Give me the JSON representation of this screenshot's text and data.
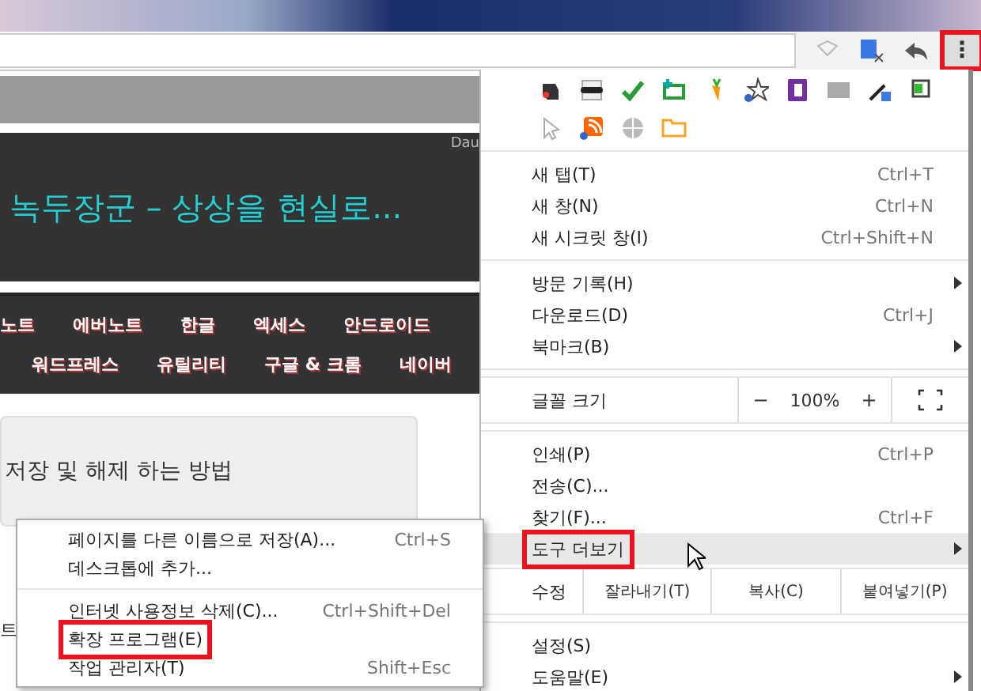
{
  "toolbar": {
    "menu_button": {
      "label": "⋮",
      "highlighted": true
    }
  },
  "page": {
    "banner_title": "녹두장군 – 상상을 현실로...",
    "banner_corner": "Dau",
    "nav_rows": [
      [
        "노트",
        "에버노트",
        "한글",
        "엑세스",
        "안드로이드"
      ],
      [
        "워드프레스",
        "유틸리티",
        "구글 & 크롬",
        "네이버"
      ]
    ],
    "post_title": "저장 및 해제 하는 방법",
    "edge_text": "트"
  },
  "menu": {
    "entries": [
      {
        "kind": "item",
        "label": "새 탭(T)",
        "shortcut": "Ctrl+T",
        "submenu": false,
        "selected": false,
        "highlighted": false
      },
      {
        "kind": "item",
        "label": "새 창(N)",
        "shortcut": "Ctrl+N",
        "submenu": false,
        "selected": false,
        "highlighted": false
      },
      {
        "kind": "item",
        "label": "새 시크릿 창(I)",
        "shortcut": "Ctrl+Shift+N",
        "submenu": false,
        "selected": false,
        "highlighted": false
      },
      {
        "kind": "separator"
      },
      {
        "kind": "item",
        "label": "방문 기록(H)",
        "submenu": true,
        "selected": false,
        "highlighted": false
      },
      {
        "kind": "item",
        "label": "다운로드(D)",
        "shortcut": "Ctrl+J",
        "submenu": false,
        "selected": false,
        "highlighted": false
      },
      {
        "kind": "item",
        "label": "북마크(B)",
        "submenu": true,
        "selected": false,
        "highlighted": false
      },
      {
        "kind": "separator"
      },
      {
        "kind": "zoom",
        "label": "글꼴 크기",
        "minus": "−",
        "value": "100%",
        "plus": "+"
      },
      {
        "kind": "separator"
      },
      {
        "kind": "item",
        "label": "인쇄(P)",
        "shortcut": "Ctrl+P",
        "submenu": false,
        "selected": false,
        "highlighted": false
      },
      {
        "kind": "item",
        "label": "전송(C)...",
        "submenu": false,
        "selected": false,
        "highlighted": false
      },
      {
        "kind": "item",
        "label": "찾기(F)...",
        "shortcut": "Ctrl+F",
        "submenu": false,
        "selected": false,
        "highlighted": false
      },
      {
        "kind": "item",
        "label": "도구 더보기",
        "submenu": true,
        "selected": true,
        "highlighted": true
      },
      {
        "kind": "edit",
        "label": "수정",
        "buttons": [
          "잘라내기(T)",
          "복사(C)",
          "붙여넣기(P)"
        ]
      },
      {
        "kind": "separator"
      },
      {
        "kind": "item",
        "label": "설정(S)",
        "submenu": false,
        "selected": false,
        "highlighted": false
      },
      {
        "kind": "item",
        "label": "도움말(E)",
        "submenu": true,
        "selected": false,
        "highlighted": false
      }
    ]
  },
  "submenu": {
    "entries": [
      {
        "kind": "item",
        "label": "페이지를 다른 이름으로 저장(A)...",
        "shortcut": "Ctrl+S",
        "highlighted": false
      },
      {
        "kind": "item",
        "label": "데스크톱에 추가...",
        "highlighted": false
      },
      {
        "kind": "separator"
      },
      {
        "kind": "item",
        "label": "인터넷 사용정보 삭제(C)...",
        "shortcut": "Ctrl+Shift+Del",
        "highlighted": false
      },
      {
        "kind": "item",
        "label": "확장 프로그램(E)",
        "highlighted": true
      },
      {
        "kind": "item",
        "label": "작업 관리자(T)",
        "shortcut": "Shift+Esc",
        "highlighted": false
      }
    ]
  }
}
